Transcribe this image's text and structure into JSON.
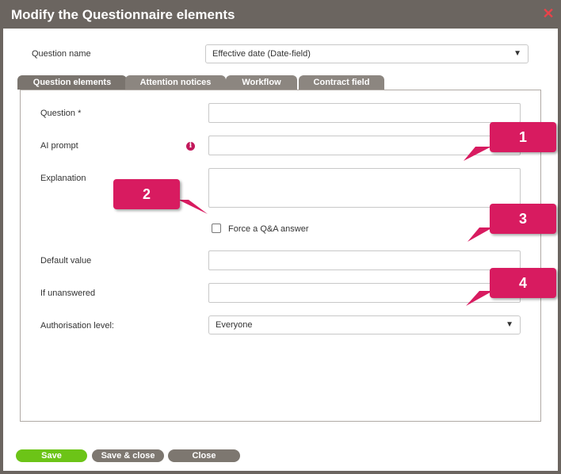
{
  "dialog": {
    "title": "Modify the Questionnaire elements",
    "close_icon": "close-icon",
    "question_name_label": "Question name",
    "question_name_value": "Effective date (Date-field)"
  },
  "tabs": [
    {
      "label": "Question elements",
      "active": true
    },
    {
      "label": "Attention notices",
      "active": false
    },
    {
      "label": "Workflow",
      "active": false
    },
    {
      "label": "Contract field",
      "active": false
    }
  ],
  "form": {
    "question_label": "Question *",
    "ai_prompt_label": "AI prompt",
    "info_icon_glyph": "i",
    "explanation_label": "Explanation",
    "force_qa_label": "Force a Q&A answer",
    "default_value_label": "Default value",
    "if_unanswered_label": "If unanswered",
    "authorisation_label": "Authorisation level:",
    "authorisation_value": "Everyone"
  },
  "callouts": [
    "1",
    "2",
    "3",
    "4"
  ],
  "buttons": {
    "save": "Save",
    "save_close": "Save & close",
    "close": "Close"
  },
  "colors": {
    "titlebar": "#6b6560",
    "tab": "#8c8680",
    "callout": "#d81b60",
    "save_button": "#6cc417",
    "secondary_button": "#7d7770",
    "close_icon": "#e8434a"
  }
}
